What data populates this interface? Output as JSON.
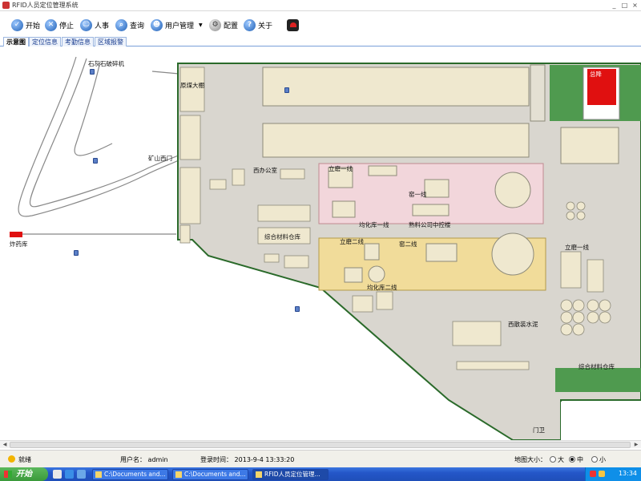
{
  "window": {
    "title": "RFID人员定位管理系统",
    "controls": [
      "_",
      "□",
      "×"
    ]
  },
  "toolbar": {
    "start": "开始",
    "stop": "停止",
    "personnel": "人事",
    "query": "查询",
    "user_mgmt": "用户管理",
    "config": "配置",
    "about": "关于"
  },
  "tabs": [
    {
      "label": "示意图",
      "active": true
    },
    {
      "label": "定位信息",
      "active": false
    },
    {
      "label": "考勤信息",
      "active": false
    },
    {
      "label": "区域报警",
      "active": false
    }
  ],
  "map": {
    "labels": {
      "crusher": "石灰石破碎机",
      "coal_shed": "原煤大棚",
      "west_gate": "矿山西门",
      "explosive_store": "炸药库",
      "west_office": "西办公室",
      "mill_line1": "立磨一线",
      "kiln_line1": "窑一线",
      "homog_line1": "均化库一线",
      "central_control": "熟料公司中控楼",
      "materials_store1": "综合材料仓库",
      "mill_line2": "立磨二线",
      "kiln_line2": "窑二线",
      "homog_line2": "均化库二线",
      "mill_line3": "立磨一线",
      "west_bulk_cement": "西散装水泥",
      "materials_store2": "综合材料仓库",
      "boiler": "总降",
      "guard": "门卫"
    }
  },
  "statusbar": {
    "state": "就绪",
    "user_label": "用户名：",
    "user": "admin",
    "login_label": "登录时间：",
    "login_time": "2013-9-4  13:33:20",
    "map_size_label": "地图大小：",
    "size_options": [
      {
        "label": "大",
        "checked": false
      },
      {
        "label": "中",
        "checked": true
      },
      {
        "label": "小",
        "checked": false
      }
    ]
  },
  "taskbar": {
    "start": "开始",
    "tasks": [
      {
        "label": "C:\\Documents and...",
        "active": false
      },
      {
        "label": "C:\\Documents and...",
        "active": false
      },
      {
        "label": "RFID人员定位管理...",
        "active": true
      }
    ],
    "clock": "13:34"
  },
  "colors": {
    "accent": "#2456c8",
    "grass": "#4f9a4f",
    "building": "#efe8cf",
    "pink_zone": "#f2d6db",
    "yellow_zone": "#f1dc9a",
    "alarm": "#e01010"
  }
}
